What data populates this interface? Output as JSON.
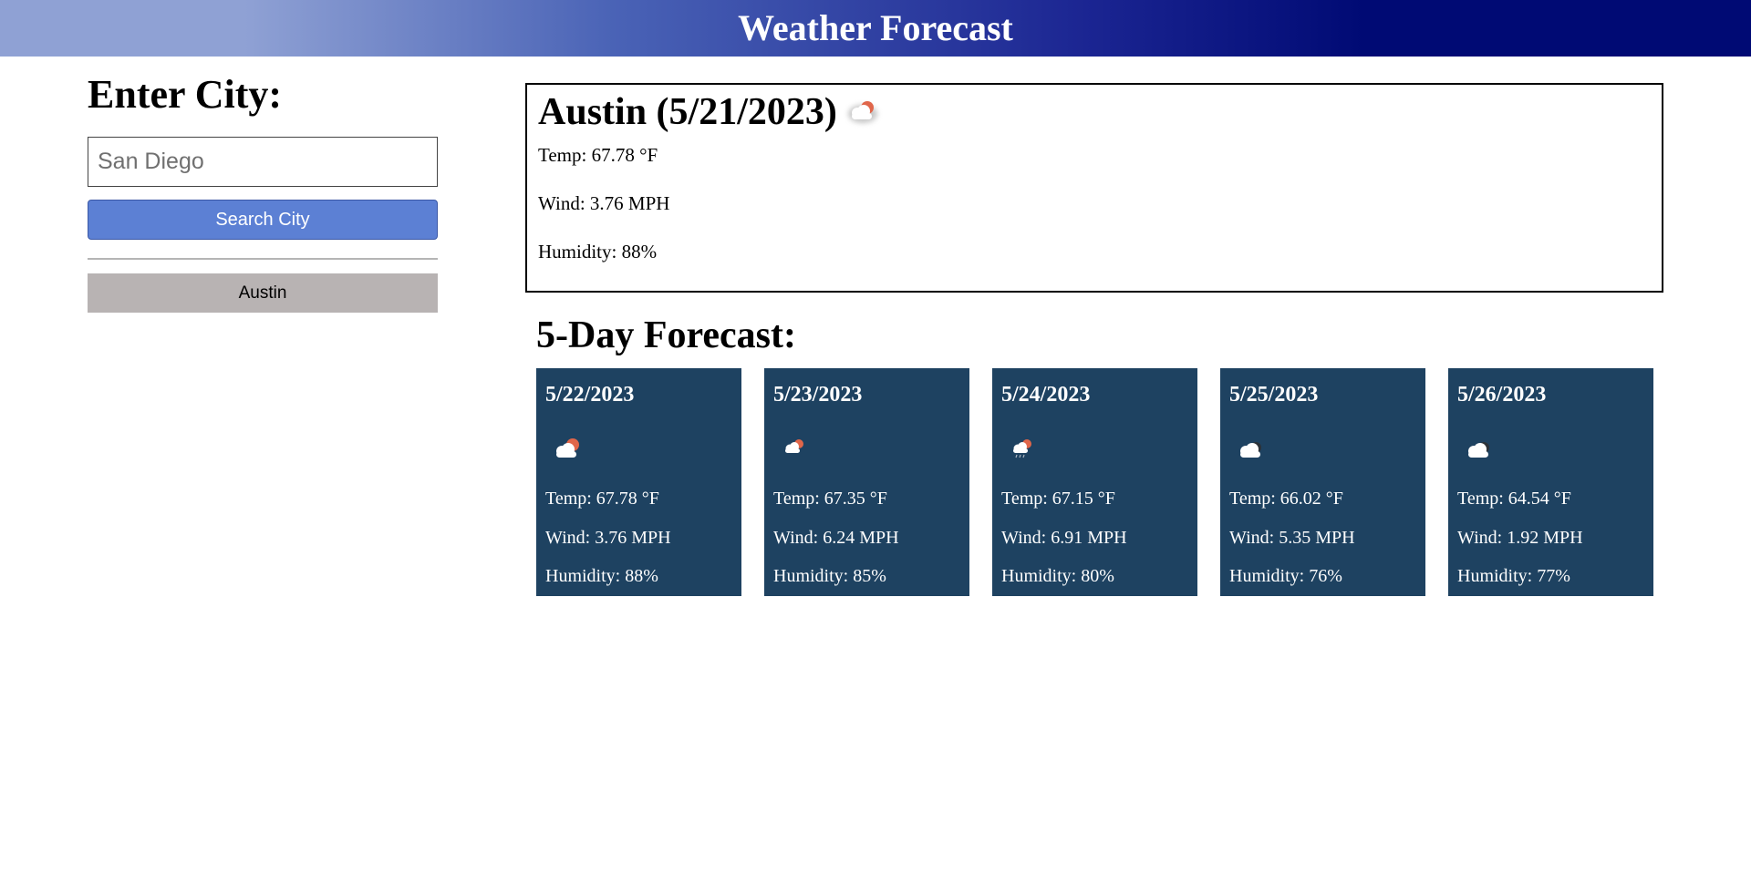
{
  "header": {
    "title": "Weather Forecast"
  },
  "search": {
    "heading": "Enter City:",
    "placeholder": "San Diego",
    "button_label": "Search City"
  },
  "history": [
    {
      "label": "Austin"
    }
  ],
  "current": {
    "title": "Austin (5/21/2023)",
    "icon": "partly-cloudy-day-icon",
    "temp": "Temp: 67.78 °F",
    "wind": "Wind: 3.76 MPH",
    "humidity": "Humidity: 88%"
  },
  "forecast": {
    "heading": "5-Day Forecast:",
    "days": [
      {
        "date": "5/22/2023",
        "icon": "partly-cloudy-day-icon",
        "temp": "Temp: 67.78 °F",
        "wind": "Wind: 3.76 MPH",
        "humidity": "Humidity: 88%"
      },
      {
        "date": "5/23/2023",
        "icon": "partly-cloudy-day-icon",
        "temp": "Temp: 67.35 °F",
        "wind": "Wind: 6.24 MPH",
        "humidity": "Humidity: 85%"
      },
      {
        "date": "5/24/2023",
        "icon": "rain-cloud-sun-icon",
        "temp": "Temp: 67.15 °F",
        "wind": "Wind: 6.91 MPH",
        "humidity": "Humidity: 80%"
      },
      {
        "date": "5/25/2023",
        "icon": "cloud-night-icon",
        "temp": "Temp: 66.02 °F",
        "wind": "Wind: 5.35 MPH",
        "humidity": "Humidity: 76%"
      },
      {
        "date": "5/26/2023",
        "icon": "cloud-night-icon",
        "temp": "Temp: 64.54 °F",
        "wind": "Wind: 1.92 MPH",
        "humidity": "Humidity: 77%"
      }
    ]
  },
  "colors": {
    "header_dark": "#000a74",
    "header_light": "#8fa1d4",
    "search_button": "#5c80d4",
    "history_button": "#b8b3b3",
    "card_background": "#1e4261"
  }
}
